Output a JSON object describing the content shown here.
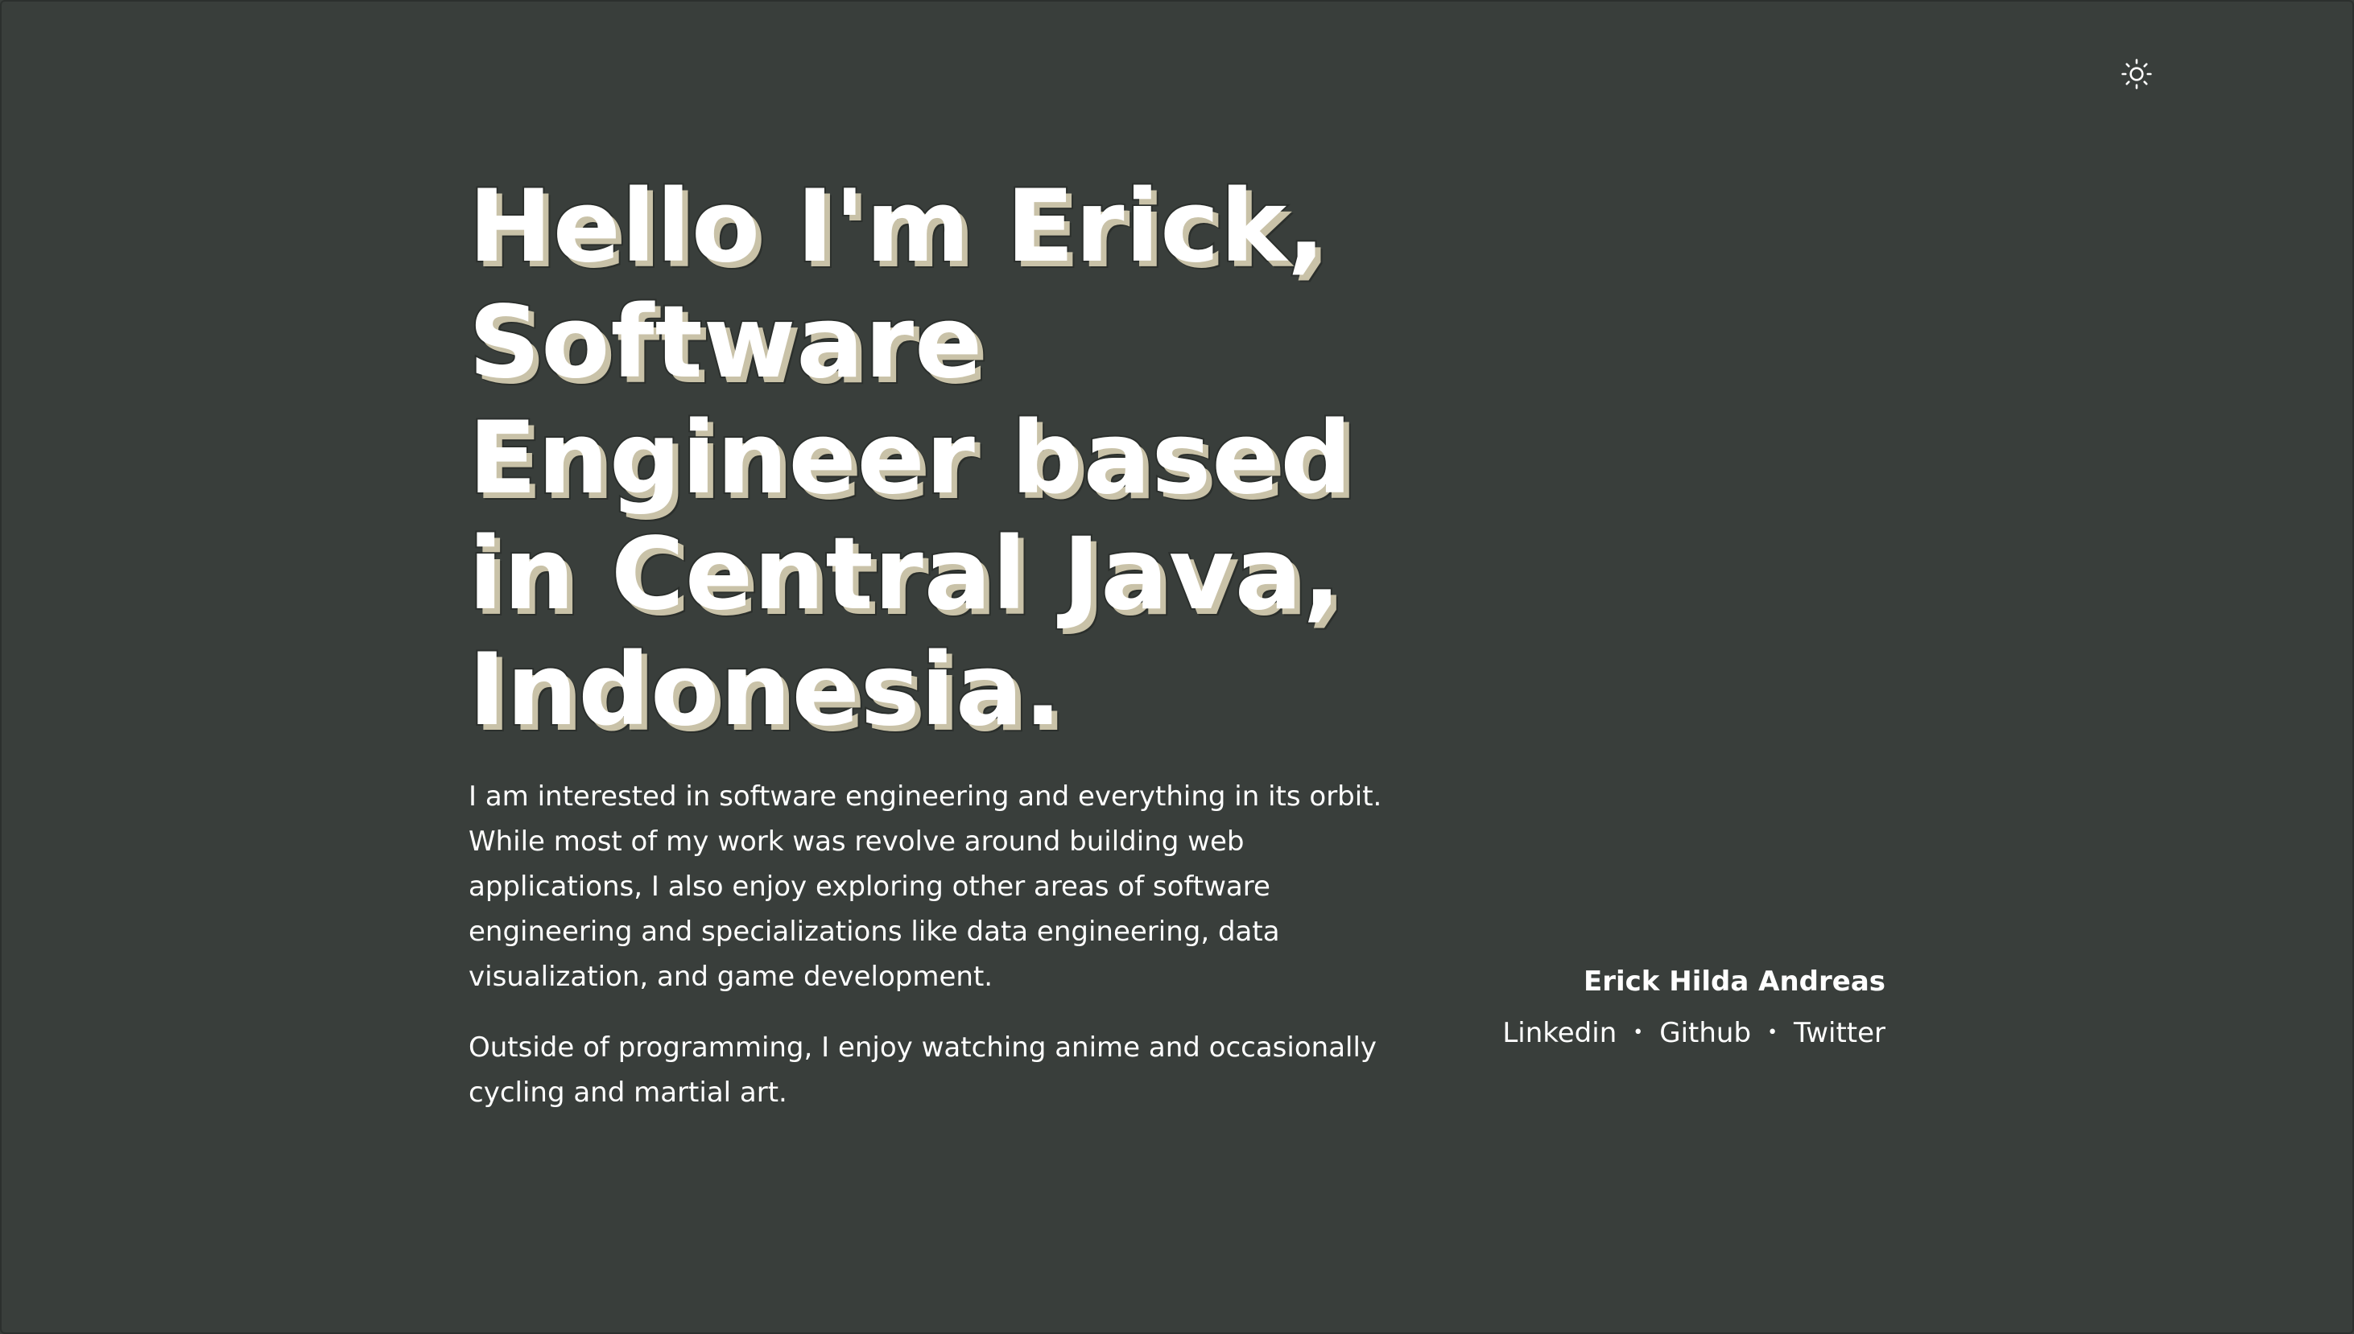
{
  "header": {
    "theme_toggle_icon": "sun-icon"
  },
  "hero": {
    "title": "Hello I'm Erick, Software Engineer based in Central Java, Indonesia."
  },
  "bio": {
    "paragraph1": "I am interested in software engineering and everything in its orbit. While most of my work was revolve around building web applications, I also enjoy exploring other areas of software engineering and specializations like data engineering, data visualization, and game development.",
    "paragraph2": "Outside of programming, I enjoy watching anime and occasionally cycling and martial art."
  },
  "signature": {
    "name": "Erick Hilda Andreas",
    "links": [
      {
        "label": "Linkedin"
      },
      {
        "label": "Github"
      },
      {
        "label": "Twitter"
      }
    ],
    "separator": "•"
  },
  "colors": {
    "background": "#393e3b",
    "text": "#ffffff",
    "title_shadow": "#c9c2a8"
  }
}
